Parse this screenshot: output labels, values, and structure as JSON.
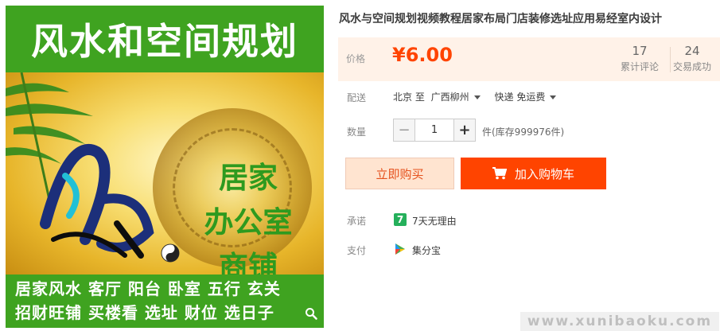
{
  "product_image": {
    "banner_title": "风水和空间规划",
    "side_text": [
      "居家",
      "办公室",
      "商铺"
    ],
    "bottom_lines": [
      "居家风水 客厅 阳台 卧室 五行 玄关",
      "招财旺铺 买楼看 选址 财位 选日子"
    ],
    "zoom_icon": "magnifier-icon"
  },
  "product": {
    "title": "风水与空间规划视频教程居家布局门店装修选址应用易经室内设计"
  },
  "price": {
    "label": "价格",
    "value": "¥6.00",
    "reviews_count": "17",
    "reviews_label": "累计评论",
    "sales_count": "24",
    "sales_label": "交易成功"
  },
  "delivery": {
    "label": "配送",
    "from": "北京 至",
    "to": "广西柳州",
    "method": "快递 免运费"
  },
  "quantity": {
    "label": "数量",
    "value": "1",
    "minus": "−",
    "plus": "+",
    "stock": "件(库存999976件)"
  },
  "actions": {
    "buy_now": "立即购买",
    "add_to_cart": "加入购物车",
    "cart_icon": "cart-icon"
  },
  "promise": {
    "label": "承诺",
    "text": "7天无理由",
    "icon_glyph": "7"
  },
  "payment": {
    "label": "支付",
    "text": "集分宝"
  },
  "watermark": "www.xunibaoku.com",
  "colors": {
    "accent": "#ff4400",
    "green": "#3fa320",
    "price_bg": "#fff2e8"
  }
}
